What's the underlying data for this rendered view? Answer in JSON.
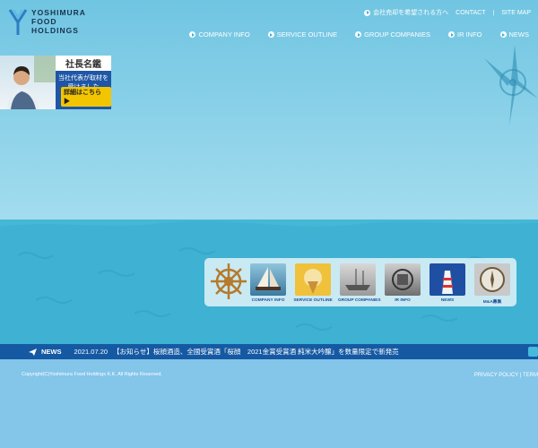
{
  "brand": {
    "line1": "YOSHIMURA",
    "line2": "FOOD",
    "line3": "HOLDINGS"
  },
  "top_links": {
    "sell_company": "会社売却を希望される方へ",
    "contact": "CONTACT",
    "sep": "|",
    "sitemap": "SITE MAP"
  },
  "nav": [
    {
      "label": "COMPANY INFO"
    },
    {
      "label": "SERVICE OUTLINE"
    },
    {
      "label": "GROUP COMPANIES"
    },
    {
      "label": "IR INFO"
    },
    {
      "label": "NEWS"
    }
  ],
  "banner": {
    "badge": "社長名鑑",
    "line1": "当社代表が取材を",
    "line2": "受けました",
    "cta": "詳細はこちら ▶"
  },
  "tiles": [
    {
      "label": "COMPANY INFO"
    },
    {
      "label": "SERVICE OUTLINE"
    },
    {
      "label": "GROUP COMPANIES"
    },
    {
      "label": "IR INFO"
    },
    {
      "label": "NEWS"
    },
    {
      "label": "M&A募集"
    }
  ],
  "news": {
    "tag": "NEWS",
    "date": "2021.07.20",
    "text": "【お知らせ】桜顔酒造、全國受賞酒「桜顔　2021金賞受賞酒 純米大吟醸」を数量限定で新発売"
  },
  "footer": {
    "copyright": "Copyright(C)Yoshimura Food Holdings K.K. All Rights Reserved.",
    "privacy": "PRIVACY POLICY",
    "sep": "|",
    "terms": "TERM"
  },
  "colors": {
    "accent": "#1559a3",
    "sky": "#70c5e2",
    "sea": "#44b7d6"
  }
}
